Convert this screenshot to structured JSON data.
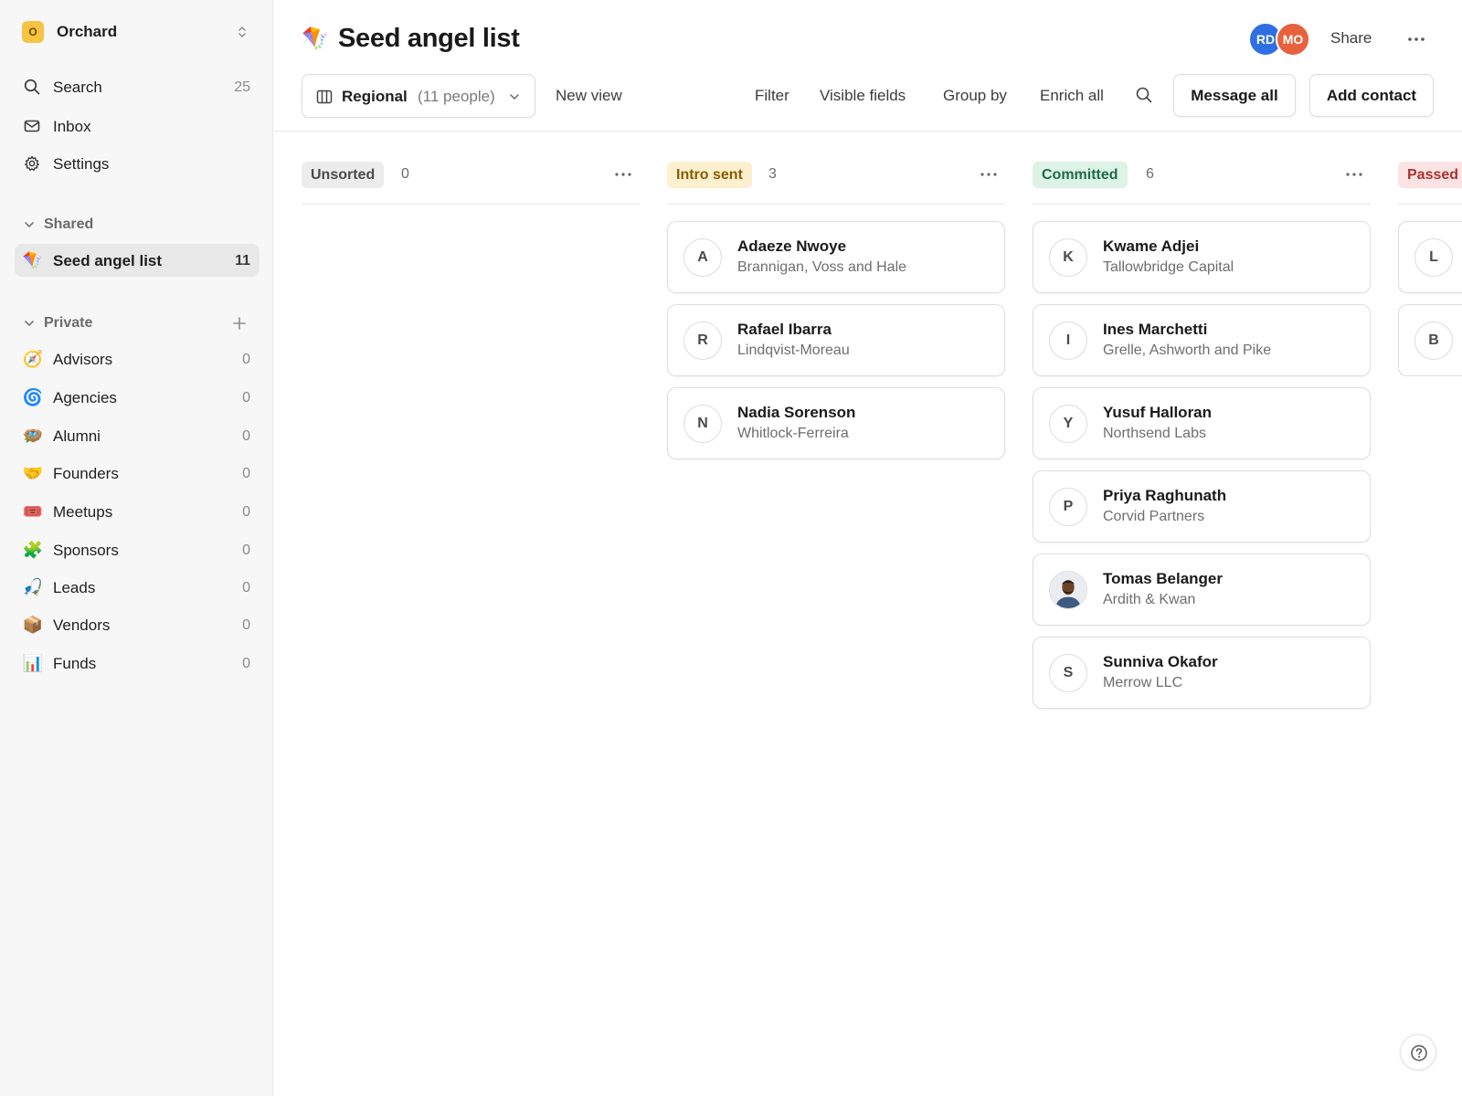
{
  "workspace": {
    "badge": "O",
    "name": "Orchard"
  },
  "nav": {
    "search": {
      "label": "Search",
      "count": "25"
    },
    "inbox": {
      "label": "Inbox"
    },
    "settings": {
      "label": "Settings"
    }
  },
  "shared": {
    "header": "Shared",
    "items": [
      {
        "emoji": "🪁",
        "label": "Seed angel list",
        "count": "11"
      }
    ]
  },
  "private": {
    "header": "Private",
    "items": [
      {
        "emoji": "🧭",
        "label": "Advisors",
        "count": "0"
      },
      {
        "emoji": "🌀",
        "label": "Agencies",
        "count": "0"
      },
      {
        "emoji": "🪺",
        "label": "Alumni",
        "count": "0"
      },
      {
        "emoji": "🤝",
        "label": "Founders",
        "count": "0"
      },
      {
        "emoji": "🎟️",
        "label": "Meetups",
        "count": "0"
      },
      {
        "emoji": "🧩",
        "label": "Sponsors",
        "count": "0"
      },
      {
        "emoji": "🎣",
        "label": "Leads",
        "count": "0"
      },
      {
        "emoji": "📦",
        "label": "Vendors",
        "count": "0"
      },
      {
        "emoji": "📊",
        "label": "Funds",
        "count": "0"
      }
    ]
  },
  "header": {
    "icon": "🪁",
    "title": "Seed angel list",
    "avatars": [
      "RD",
      "MO"
    ],
    "share": "Share"
  },
  "toolbar": {
    "view_name": "Regional",
    "view_meta": "(11 people)",
    "new_view": "New view",
    "filter": "Filter",
    "visible_fields": "Visible fields",
    "group_by": "Group by",
    "enrich_all": "Enrich all",
    "message_all": "Message all",
    "add_contact": "Add contact"
  },
  "columns": [
    {
      "label": "Unsorted",
      "count": "0",
      "color": "#ececec",
      "text_color": "#4a4a4a",
      "cards": []
    },
    {
      "label": "Intro sent",
      "count": "3",
      "color": "#fdf0cf",
      "text_color": "#8a5a00",
      "cards": [
        {
          "initial": "A",
          "name": "Adaeze Nwoye",
          "company": "Brannigan, Voss and Hale"
        },
        {
          "initial": "R",
          "name": "Rafael Ibarra",
          "company": "Lindqvist-Moreau"
        },
        {
          "initial": "N",
          "name": "Nadia Sorenson",
          "company": "Whitlock-Ferreira"
        }
      ]
    },
    {
      "label": "Committed",
      "count": "6",
      "color": "#dcf3e6",
      "text_color": "#1e6b43",
      "cards": [
        {
          "initial": "K",
          "name": "Kwame Adjei",
          "company": "Tallowbridge Capital"
        },
        {
          "initial": "I",
          "name": "Ines Marchetti",
          "company": "Grelle, Ashworth and Pike"
        },
        {
          "initial": "Y",
          "name": "Yusuf Halloran",
          "company": "Northsend Labs"
        },
        {
          "initial": "P",
          "name": "Priya Raghunath",
          "company": "Corvid Partners"
        },
        {
          "initial": "",
          "photo": true,
          "name": "Tomas Belanger",
          "company": "Ardith & Kwan"
        },
        {
          "initial": "S",
          "name": "Sunniva Okafor",
          "company": "Merrow LLC"
        }
      ]
    },
    {
      "label": "Passed",
      "count": "",
      "color": "#fbe3e3",
      "text_color": "#a83232",
      "cards": [
        {
          "initial": "L",
          "name": "",
          "company": ""
        },
        {
          "initial": "B",
          "name": "",
          "company": ""
        }
      ]
    }
  ]
}
